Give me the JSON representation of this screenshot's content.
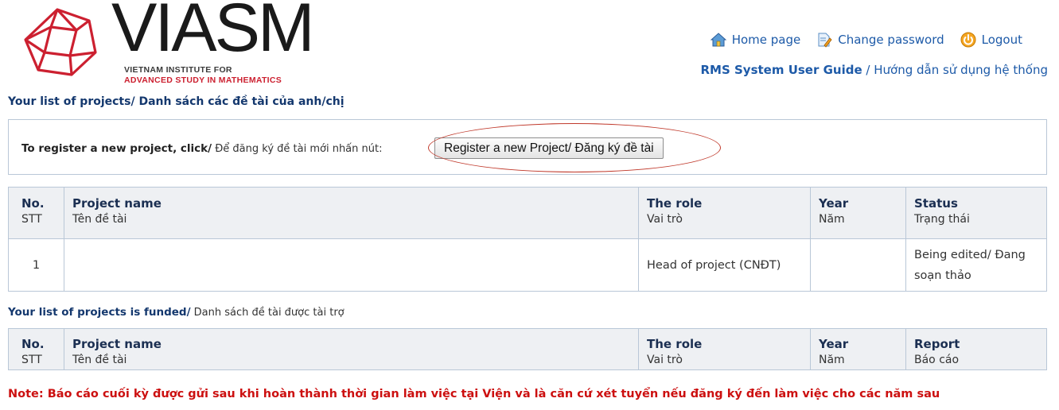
{
  "logo": {
    "wordmark": "VIASM",
    "subtitle_line1": "VIETNAM INSTITUTE FOR",
    "subtitle_line2": "ADVANCED STUDY IN MATHEMATICS",
    "mark_color": "#cc2030"
  },
  "topnav": {
    "home_label": "Home page",
    "change_password_label": "Change password",
    "logout_label": "Logout"
  },
  "guide": {
    "en": "RMS System User Guide",
    "separator": " / ",
    "vn": "Hướng dẫn sử dụng hệ thống"
  },
  "list_title": "Your list of projects/ Danh sách các đề tài của anh/chị",
  "register": {
    "lead_en": "To register a new project, click/",
    "lead_vn": " Để đăng ký đề tài mới nhấn nút:",
    "button_label": "Register a new Project/ Đăng ký đề tài"
  },
  "projects_table": {
    "headers": [
      {
        "en": "No.",
        "vn": "STT"
      },
      {
        "en": "Project name",
        "vn": "Tên đề tài"
      },
      {
        "en": "The role",
        "vn": "Vai trò"
      },
      {
        "en": "Year",
        "vn": "Năm"
      },
      {
        "en": "Status",
        "vn": "Trạng thái"
      }
    ],
    "rows": [
      {
        "no": "1",
        "name": "",
        "role": "Head of project (CNĐT)",
        "year": "",
        "status": "Being edited/ Đang soạn thảo"
      }
    ]
  },
  "funded": {
    "title_en": "Your list of projects is funded/",
    "title_vn": " Danh sách đề tài được tài trợ",
    "headers": [
      {
        "en": "No.",
        "vn": "STT"
      },
      {
        "en": "Project name",
        "vn": "Tên đề tài"
      },
      {
        "en": "The role",
        "vn": "Vai trò"
      },
      {
        "en": "Year",
        "vn": "Năm"
      },
      {
        "en": "Report",
        "vn": "Báo cáo"
      }
    ]
  },
  "note": "Note: Báo cáo cuối kỳ được gửi sau khi hoàn thành thời gian làm việc tại Viện và là căn cứ xét tuyển nếu đăng ký đến làm việc cho các năm sau",
  "colors": {
    "link": "#1d5aa8",
    "note": "#cc1010",
    "highlight_ellipse": "#c0392b"
  }
}
